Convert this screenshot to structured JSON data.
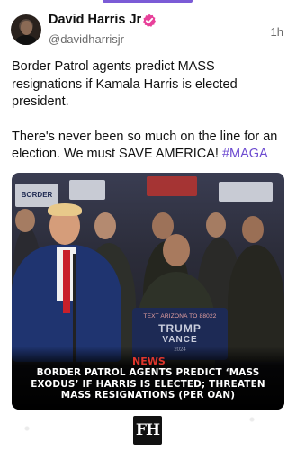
{
  "post": {
    "author_name": "David Harris Jr",
    "author_handle": "@davidharrisjr",
    "time": "1h",
    "paragraph1": "Border Patrol agents predict MASS resignations if Kamala Harris is elected president.",
    "paragraph2_text": "There's never been so much on the line for an election. We must SAVE AMERICA! ",
    "hashtag": "#MAGA"
  },
  "media": {
    "sign_left": "BORDER",
    "podium": {
      "line1": "TEXT ARIZONA TO 88022",
      "line2": "TRUMP",
      "line3": "VANCE",
      "line4": "2024"
    },
    "caption_tag": "NEWS",
    "caption": "BORDER PATROL AGENTS PREDICT ‘MASS EXODUS’ IF HARRIS IS ELECTED; THREATEN MASS RESIGNATIONS (PER OAN)"
  },
  "footer": {
    "logo_text": "FH"
  },
  "colors": {
    "accent": "#6c4ad0",
    "verified": "#e8409a",
    "news_red": "#e0362c"
  },
  "icons": {
    "verified": "verified-badge-icon"
  }
}
